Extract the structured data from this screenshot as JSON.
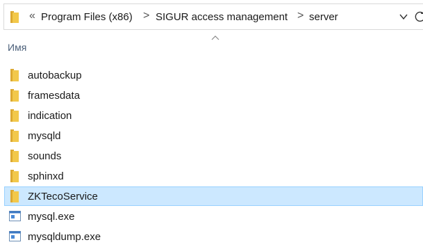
{
  "address_bar": {
    "overflow": "«",
    "separator": ">",
    "crumbs": [
      "Program Files (x86)",
      "SIGUR access management",
      "server"
    ]
  },
  "column_header": {
    "name_label": "Имя"
  },
  "files": [
    {
      "label": "autobackup",
      "type": "folder",
      "selected": false
    },
    {
      "label": "framesdata",
      "type": "folder",
      "selected": false
    },
    {
      "label": "indication",
      "type": "folder",
      "selected": false
    },
    {
      "label": "mysqld",
      "type": "folder",
      "selected": false
    },
    {
      "label": "sounds",
      "type": "folder",
      "selected": false
    },
    {
      "label": "sphinxd",
      "type": "folder",
      "selected": false
    },
    {
      "label": "ZKTecoService",
      "type": "folder",
      "selected": true
    },
    {
      "label": "mysql.exe",
      "type": "exe",
      "selected": false
    },
    {
      "label": "mysqldump.exe",
      "type": "exe",
      "selected": false
    }
  ],
  "colors": {
    "folder": "#f2c84b",
    "folder_dark": "#dca932",
    "selection_bg": "#cce8ff",
    "selection_border": "#99d1ff",
    "header_text": "#4c607a"
  }
}
